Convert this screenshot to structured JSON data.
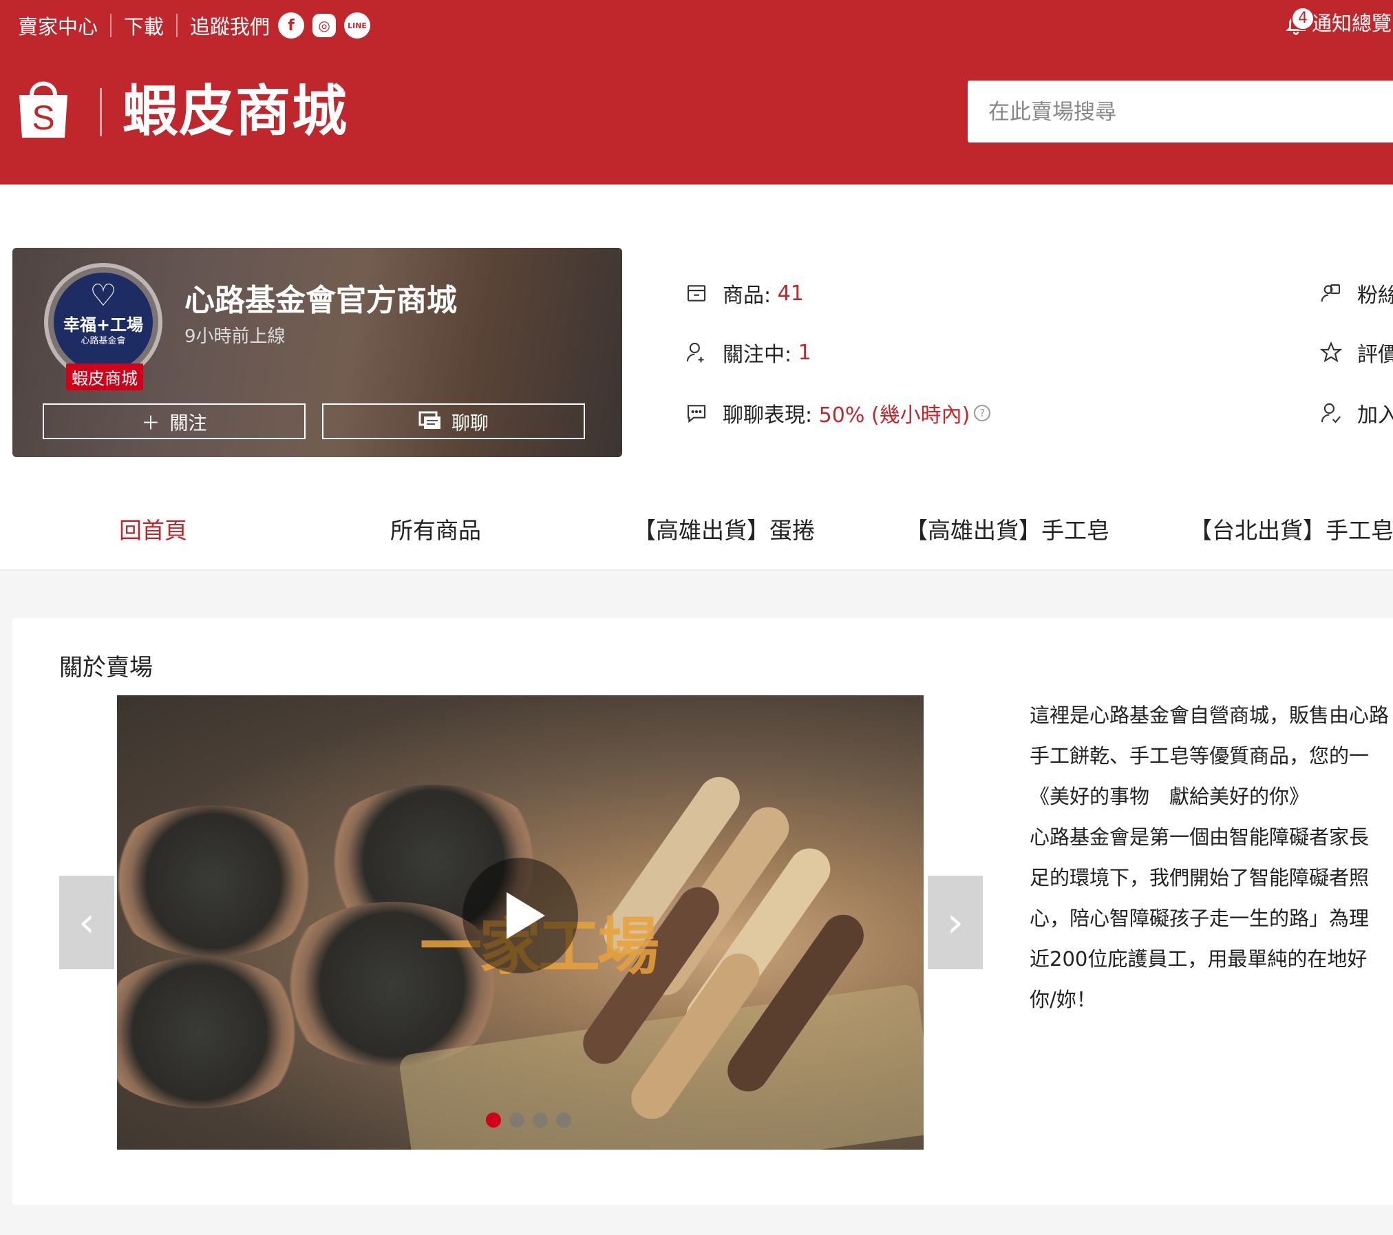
{
  "topbar": {
    "seller_center": "賣家中心",
    "download": "下載",
    "follow_us": "追蹤我們",
    "social": [
      "facebook-icon",
      "instagram-icon",
      "line-icon"
    ],
    "notification_count": "4",
    "notification_label": "通知總覽"
  },
  "brand": {
    "logo_letter": "S",
    "name": "蝦皮商城",
    "color": "#c0272d"
  },
  "search": {
    "placeholder": "在此賣場搜尋"
  },
  "shop": {
    "avatar_title": "幸福+工場",
    "avatar_subtitle": "心路基金會",
    "mall_badge": "蝦皮商城",
    "name": "心路基金會官方商城",
    "online": "9小時前上線",
    "follow_label": "關注",
    "chat_label": "聊聊"
  },
  "stats": {
    "products_label": "商品:",
    "products_value": "41",
    "following_label": "關注中:",
    "following_value": "1",
    "chat_label": "聊聊表現:",
    "chat_value": "50% (幾小時內)",
    "fans_label": "粉絲",
    "rating_label": "評價",
    "joined_label": "加入"
  },
  "tabs": [
    {
      "label": "回首頁",
      "active": true
    },
    {
      "label": "所有商品"
    },
    {
      "label": "【高雄出貨】蛋捲"
    },
    {
      "label": "【高雄出貨】手工皂"
    },
    {
      "label": "【台北出貨】手工皂"
    }
  ],
  "about": {
    "title": "關於賣場",
    "video_watermark": "一家工場",
    "carousel_active_index": 0,
    "carousel_count": 4,
    "description": [
      "這裡是心路基金會自營商城，販售由心路",
      "手工餅乾、手工皂等優質商品，您的一",
      "《美好的事物　獻給美好的你》",
      "心路基金會是第一個由智能障礙者家長",
      "足的環境下，我們開始了智能障礙者照",
      "心，陪心智障礙孩子走一生的路」為理",
      "近200位庇護員工，用最單純的在地好",
      "你/妳！"
    ]
  }
}
